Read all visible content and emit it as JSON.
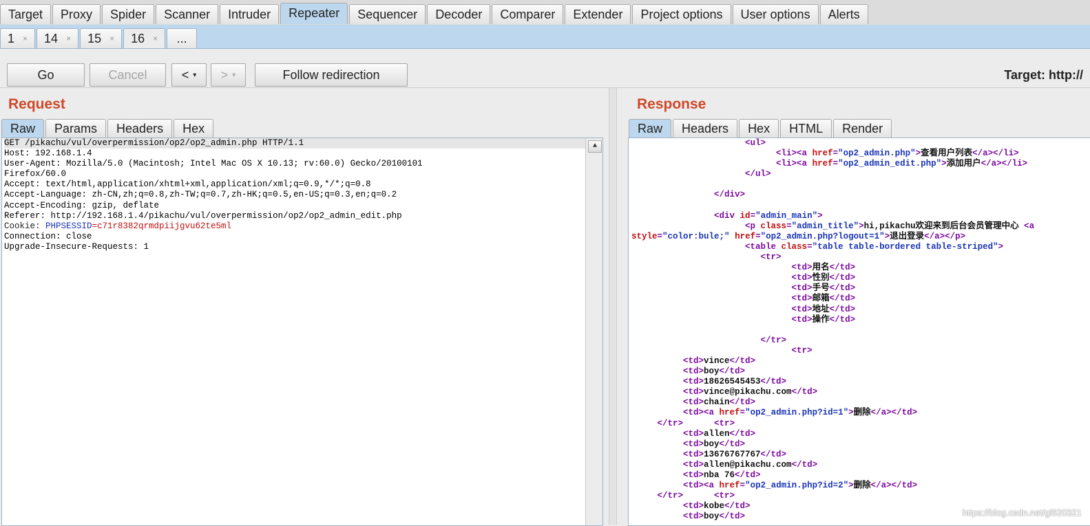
{
  "top_tabs": [
    "Target",
    "Proxy",
    "Spider",
    "Scanner",
    "Intruder",
    "Repeater",
    "Sequencer",
    "Decoder",
    "Comparer",
    "Extender",
    "Project options",
    "User options",
    "Alerts"
  ],
  "active_top_tab": "Repeater",
  "sub_tabs": [
    {
      "label": "1",
      "close": "×"
    },
    {
      "label": "14",
      "close": "×"
    },
    {
      "label": "15",
      "close": "×"
    },
    {
      "label": "16",
      "close": "×",
      "active": true
    }
  ],
  "sub_more": "...",
  "toolbar": {
    "go": "Go",
    "cancel": "Cancel",
    "back": "<",
    "forward": ">",
    "dropdown": "▾",
    "follow": "Follow redirection",
    "target": "Target: http://"
  },
  "request": {
    "title": "Request",
    "tabs": [
      "Raw",
      "Params",
      "Headers",
      "Hex"
    ],
    "active_tab": "Raw",
    "lines": [
      {
        "t": "plain",
        "text": "GET /pikachu/vul/overpermission/op2/op2_admin.php HTTP/1.1"
      },
      {
        "t": "plain",
        "text": "Host: 192.168.1.4"
      },
      {
        "t": "plain",
        "text": "User-Agent: Mozilla/5.0 (Macintosh; Intel Mac OS X 10.13; rv:60.0) Gecko/20100101"
      },
      {
        "t": "plain",
        "text": "Firefox/60.0"
      },
      {
        "t": "plain",
        "text": "Accept: text/html,application/xhtml+xml,application/xml;q=0.9,*/*;q=0.8"
      },
      {
        "t": "plain",
        "text": "Accept-Language: zh-CN,zh;q=0.8,zh-TW;q=0.7,zh-HK;q=0.5,en-US;q=0.3,en;q=0.2"
      },
      {
        "t": "plain",
        "text": "Accept-Encoding: gzip, deflate"
      },
      {
        "t": "plain",
        "text": "Referer: http://192.168.1.4/pikachu/vul/overpermission/op2/op2_admin_edit.php"
      },
      {
        "t": "cookie",
        "name": "Cookie: ",
        "key": "PHPSESSID",
        "value": "=c71r8382qrmdpiijgvu62te5ml"
      },
      {
        "t": "plain",
        "text": "Connection: close"
      },
      {
        "t": "plain",
        "text": "Upgrade-Insecure-Requests: 1"
      }
    ]
  },
  "response": {
    "title": "Response",
    "tabs": [
      "Raw",
      "Headers",
      "Hex",
      "HTML",
      "Render"
    ],
    "active_tab": "Raw",
    "lines": [
      {
        "i": "                      ",
        "s": [
          [
            "tag",
            "<ul>"
          ]
        ]
      },
      {
        "i": "                            ",
        "s": [
          [
            "tag",
            "<li><a "
          ],
          [
            "attr",
            "href"
          ],
          [
            "tag",
            "="
          ],
          [
            "val",
            "\"op2_admin.php\""
          ],
          [
            "tag",
            ">"
          ],
          [
            "txt",
            "查看用户列表"
          ],
          [
            "tag",
            "</a></li>"
          ]
        ]
      },
      {
        "i": "                            ",
        "s": [
          [
            "tag",
            "<li><a "
          ],
          [
            "attr",
            "href"
          ],
          [
            "tag",
            "="
          ],
          [
            "val",
            "\"op2_admin_edit.php\""
          ],
          [
            "tag",
            ">"
          ],
          [
            "txt",
            "添加用户"
          ],
          [
            "tag",
            "</a></li>"
          ]
        ]
      },
      {
        "i": "                      ",
        "s": [
          [
            "tag",
            "</ul>"
          ]
        ]
      },
      {
        "i": "",
        "s": []
      },
      {
        "i": "                ",
        "s": [
          [
            "tag",
            "</div>"
          ]
        ]
      },
      {
        "i": "",
        "s": []
      },
      {
        "i": "                ",
        "s": [
          [
            "tag",
            "<div "
          ],
          [
            "attr",
            "id"
          ],
          [
            "tag",
            "="
          ],
          [
            "val",
            "\"admin_main\""
          ],
          [
            "tag",
            ">"
          ]
        ]
      },
      {
        "i": "                      ",
        "s": [
          [
            "tag",
            "<p "
          ],
          [
            "attr",
            "class"
          ],
          [
            "tag",
            "="
          ],
          [
            "val",
            "\"admin_title\""
          ],
          [
            "tag",
            ">"
          ],
          [
            "txt",
            "hi,pikachu欢迎来到后台会员管理中心 "
          ],
          [
            "tag",
            "<a"
          ]
        ]
      },
      {
        "i": "",
        "s": [
          [
            "attr",
            "style"
          ],
          [
            "tag",
            "="
          ],
          [
            "val",
            "\"color:bule;\""
          ],
          [
            "tag",
            " "
          ],
          [
            "attr",
            "href"
          ],
          [
            "tag",
            "="
          ],
          [
            "val",
            "\"op2_admin.php?logout=1\""
          ],
          [
            "tag",
            ">"
          ],
          [
            "txt",
            "退出登录"
          ],
          [
            "tag",
            "</a></p>"
          ]
        ]
      },
      {
        "i": "                      ",
        "s": [
          [
            "tag",
            "<table "
          ],
          [
            "attr",
            "class"
          ],
          [
            "tag",
            "="
          ],
          [
            "val",
            "\"table table-bordered table-striped\""
          ],
          [
            "tag",
            ">"
          ]
        ]
      },
      {
        "i": "                         ",
        "s": [
          [
            "tag",
            "<tr>"
          ]
        ]
      },
      {
        "i": "                               ",
        "s": [
          [
            "tag",
            "<td>"
          ],
          [
            "txt",
            "用名"
          ],
          [
            "tag",
            "</td>"
          ]
        ]
      },
      {
        "i": "                               ",
        "s": [
          [
            "tag",
            "<td>"
          ],
          [
            "txt",
            "性别"
          ],
          [
            "tag",
            "</td>"
          ]
        ]
      },
      {
        "i": "                               ",
        "s": [
          [
            "tag",
            "<td>"
          ],
          [
            "txt",
            "手号"
          ],
          [
            "tag",
            "</td>"
          ]
        ]
      },
      {
        "i": "                               ",
        "s": [
          [
            "tag",
            "<td>"
          ],
          [
            "txt",
            "邮箱"
          ],
          [
            "tag",
            "</td>"
          ]
        ]
      },
      {
        "i": "                               ",
        "s": [
          [
            "tag",
            "<td>"
          ],
          [
            "txt",
            "地址"
          ],
          [
            "tag",
            "</td>"
          ]
        ]
      },
      {
        "i": "                               ",
        "s": [
          [
            "tag",
            "<td>"
          ],
          [
            "txt",
            "操作"
          ],
          [
            "tag",
            "</td>"
          ]
        ]
      },
      {
        "i": "",
        "s": []
      },
      {
        "i": "                         ",
        "s": [
          [
            "tag",
            "</tr>"
          ]
        ]
      },
      {
        "i": "                               ",
        "s": [
          [
            "tag",
            "<tr>"
          ]
        ]
      },
      {
        "i": "          ",
        "s": [
          [
            "tag",
            "<td>"
          ],
          [
            "txt",
            "vince"
          ],
          [
            "tag",
            "</td>"
          ]
        ]
      },
      {
        "i": "          ",
        "s": [
          [
            "tag",
            "<td>"
          ],
          [
            "txt",
            "boy"
          ],
          [
            "tag",
            "</td>"
          ]
        ]
      },
      {
        "i": "          ",
        "s": [
          [
            "tag",
            "<td>"
          ],
          [
            "txt",
            "18626545453"
          ],
          [
            "tag",
            "</td>"
          ]
        ]
      },
      {
        "i": "          ",
        "s": [
          [
            "tag",
            "<td>"
          ],
          [
            "txt",
            "vince@pikachu.com"
          ],
          [
            "tag",
            "</td>"
          ]
        ]
      },
      {
        "i": "          ",
        "s": [
          [
            "tag",
            "<td>"
          ],
          [
            "txt",
            "chain"
          ],
          [
            "tag",
            "</td>"
          ]
        ]
      },
      {
        "i": "          ",
        "s": [
          [
            "tag",
            "<td><a "
          ],
          [
            "attr",
            "href"
          ],
          [
            "tag",
            "="
          ],
          [
            "val",
            "\"op2_admin.php?id=1\""
          ],
          [
            "tag",
            ">"
          ],
          [
            "txt",
            "删除"
          ],
          [
            "tag",
            "</a></td>"
          ]
        ]
      },
      {
        "i": "     ",
        "s": [
          [
            "tag",
            "</tr>"
          ],
          [
            "tag",
            "      <tr>"
          ]
        ]
      },
      {
        "i": "          ",
        "s": [
          [
            "tag",
            "<td>"
          ],
          [
            "txt",
            "allen"
          ],
          [
            "tag",
            "</td>"
          ]
        ]
      },
      {
        "i": "          ",
        "s": [
          [
            "tag",
            "<td>"
          ],
          [
            "txt",
            "boy"
          ],
          [
            "tag",
            "</td>"
          ]
        ]
      },
      {
        "i": "          ",
        "s": [
          [
            "tag",
            "<td>"
          ],
          [
            "txt",
            "13676767767"
          ],
          [
            "tag",
            "</td>"
          ]
        ]
      },
      {
        "i": "          ",
        "s": [
          [
            "tag",
            "<td>"
          ],
          [
            "txt",
            "allen@pikachu.com"
          ],
          [
            "tag",
            "</td>"
          ]
        ]
      },
      {
        "i": "          ",
        "s": [
          [
            "tag",
            "<td>"
          ],
          [
            "txt",
            "nba 76"
          ],
          [
            "tag",
            "</td>"
          ]
        ]
      },
      {
        "i": "          ",
        "s": [
          [
            "tag",
            "<td><a "
          ],
          [
            "attr",
            "href"
          ],
          [
            "tag",
            "="
          ],
          [
            "val",
            "\"op2_admin.php?id=2\""
          ],
          [
            "tag",
            ">"
          ],
          [
            "txt",
            "删除"
          ],
          [
            "tag",
            "</a></td>"
          ]
        ]
      },
      {
        "i": "     ",
        "s": [
          [
            "tag",
            "</tr>"
          ],
          [
            "tag",
            "      <tr>"
          ]
        ]
      },
      {
        "i": "          ",
        "s": [
          [
            "tag",
            "<td>"
          ],
          [
            "txt",
            "kobe"
          ],
          [
            "tag",
            "</td>"
          ]
        ]
      },
      {
        "i": "          ",
        "s": [
          [
            "tag",
            "<td>"
          ],
          [
            "txt",
            "boy"
          ],
          [
            "tag",
            "</td>"
          ]
        ]
      }
    ]
  },
  "watermark": "https://blog.csdn.net/gl620321"
}
